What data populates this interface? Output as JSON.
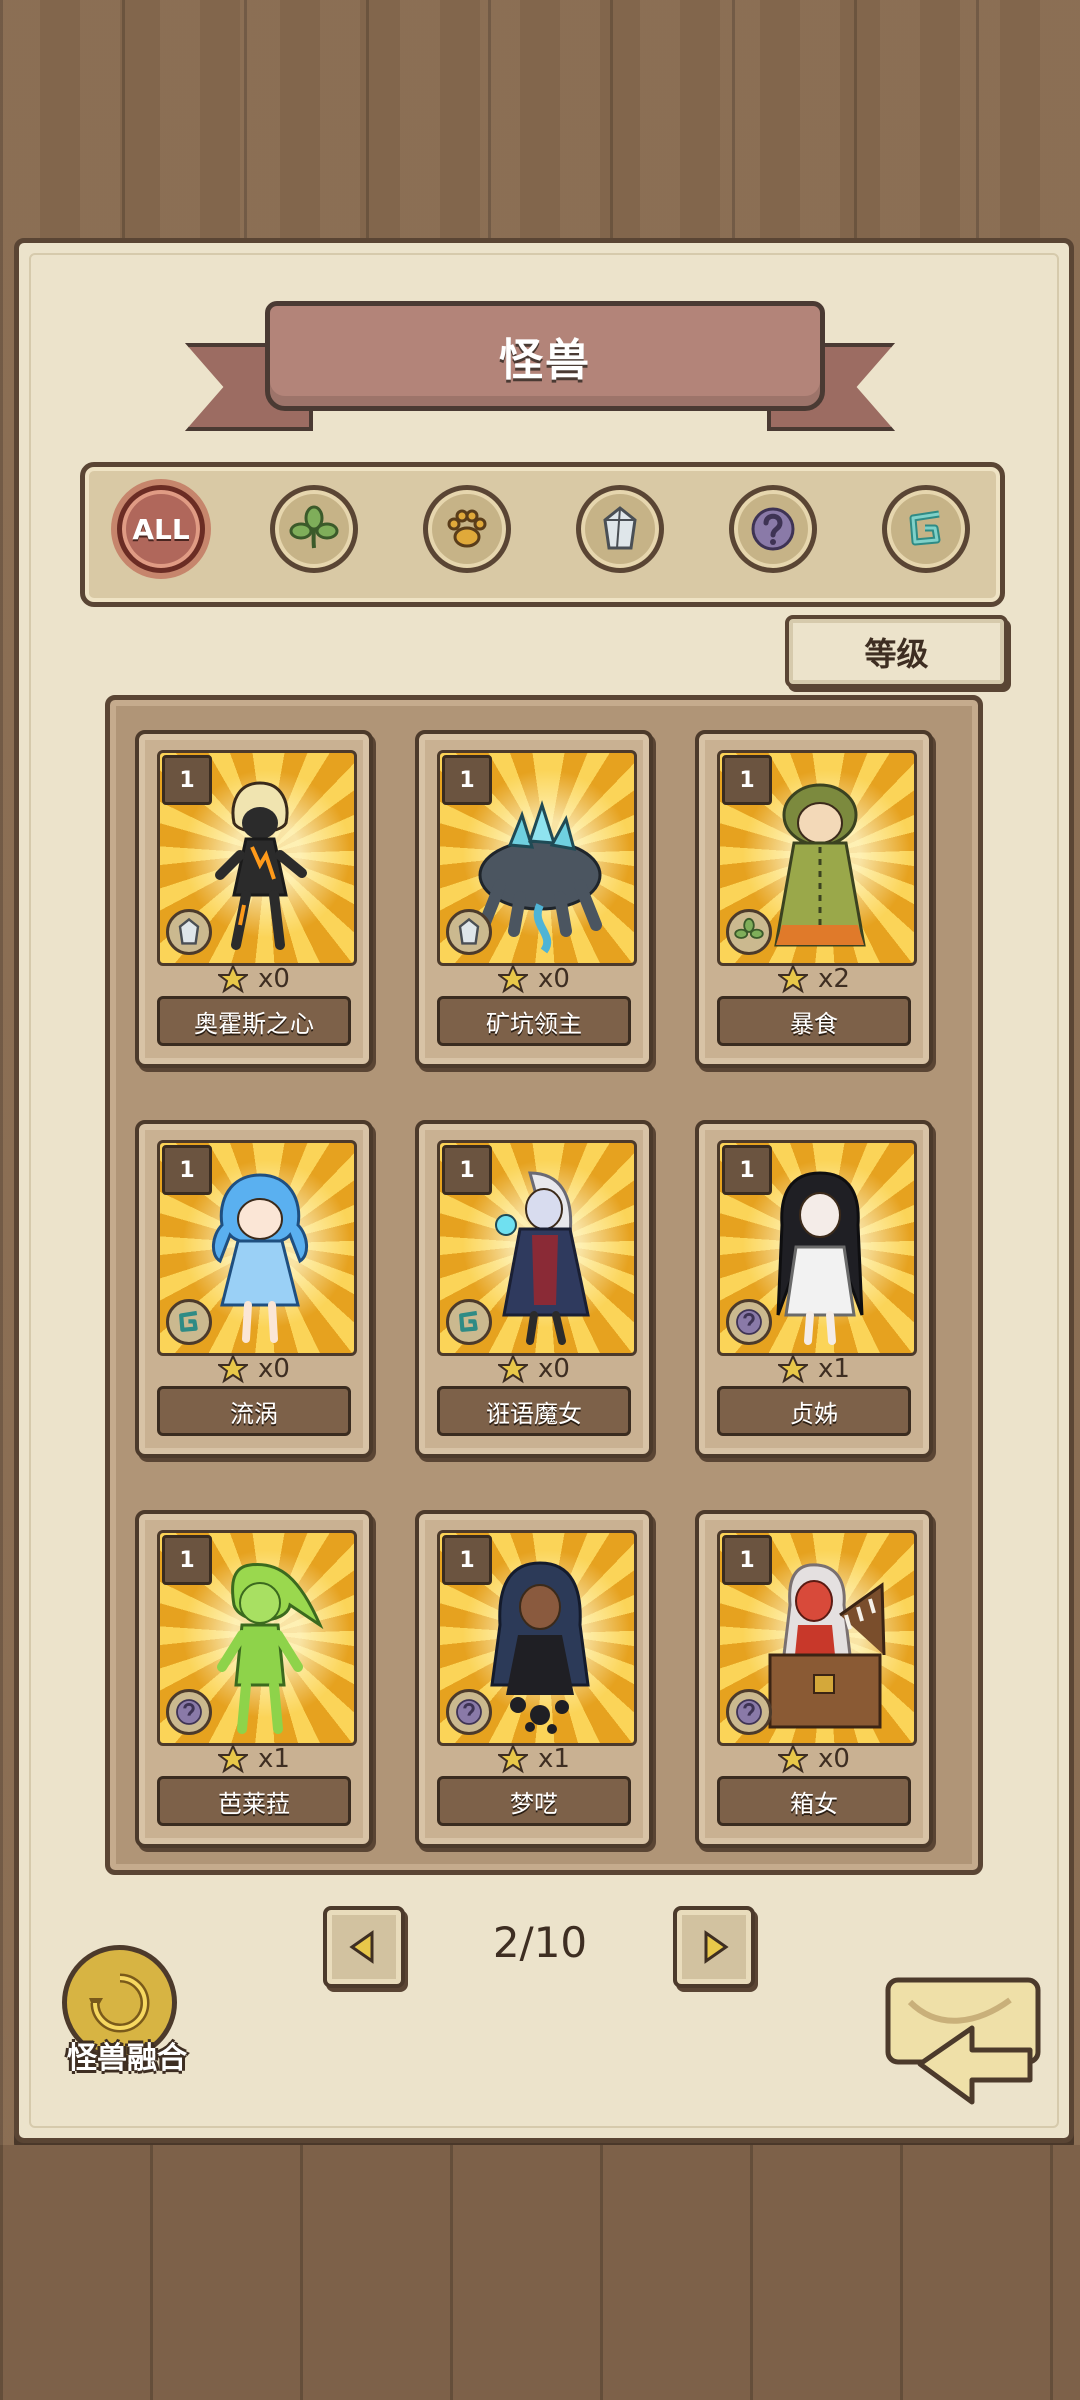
{
  "header": {
    "title": "怪兽"
  },
  "filters": [
    {
      "id": "all",
      "label": "ALL",
      "icon": "all-icon",
      "active": true
    },
    {
      "id": "plant",
      "label": "",
      "icon": "leaf-icon",
      "active": false
    },
    {
      "id": "beast",
      "label": "",
      "icon": "paw-icon",
      "active": false
    },
    {
      "id": "mineral",
      "label": "",
      "icon": "crystal-icon",
      "active": false
    },
    {
      "id": "unknown",
      "label": "",
      "icon": "question-icon",
      "active": false
    },
    {
      "id": "water",
      "label": "",
      "icon": "swirl-icon",
      "active": false
    }
  ],
  "sort": {
    "label": "等级"
  },
  "cards": [
    {
      "name": "奥霍斯之心",
      "level": "1",
      "count": "x0",
      "type_icon": "crystal-icon"
    },
    {
      "name": "矿坑领主",
      "level": "1",
      "count": "x0",
      "type_icon": "crystal-icon"
    },
    {
      "name": "暴食",
      "level": "1",
      "count": "x2",
      "type_icon": "leaf-icon"
    },
    {
      "name": "流涡",
      "level": "1",
      "count": "x0",
      "type_icon": "swirl-icon"
    },
    {
      "name": "诳语魔女",
      "level": "1",
      "count": "x0",
      "type_icon": "swirl-icon"
    },
    {
      "name": "贞姊",
      "level": "1",
      "count": "x1",
      "type_icon": "question-icon"
    },
    {
      "name": "芭莱菈",
      "level": "1",
      "count": "x1",
      "type_icon": "question-icon"
    },
    {
      "name": "梦呓",
      "level": "1",
      "count": "x1",
      "type_icon": "question-icon"
    },
    {
      "name": "箱女",
      "level": "1",
      "count": "x0",
      "type_icon": "question-icon"
    }
  ],
  "pagination": {
    "current": "2/10"
  },
  "fusion": {
    "label": "怪兽融合"
  },
  "colors": {
    "parchment": "#ece3cb",
    "accent": "#b0675b",
    "wood": "#876a4f",
    "plate": "#7d6149"
  }
}
